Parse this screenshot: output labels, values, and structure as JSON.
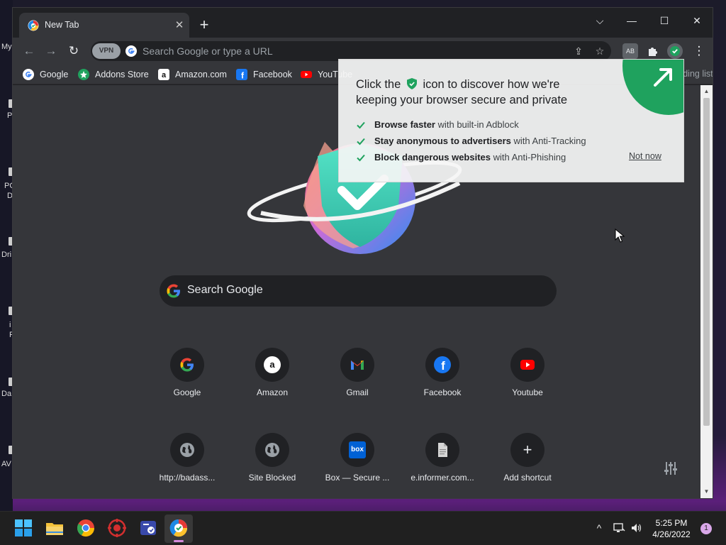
{
  "desktop": {
    "side_labels": [
      "My",
      "P",
      "PC",
      "D",
      "Dri",
      "i",
      "F",
      "Da",
      "AV"
    ]
  },
  "tab": {
    "title": "New Tab",
    "close_glyph": "✕"
  },
  "new_tab_glyph": "+",
  "window_controls": {
    "dropdown": "⌵",
    "minimize": "—",
    "maximize": "☐",
    "close": "✕"
  },
  "toolbar": {
    "back": "←",
    "forward": "→",
    "reload": "↻",
    "vpn_label": "VPN",
    "omnibox_placeholder": "Search Google or type a URL",
    "share": "⇪",
    "star": "☆",
    "menu": "⋮"
  },
  "bookmarks": [
    {
      "label": "Google",
      "icon": "google-icon"
    },
    {
      "label": "Addons Store",
      "icon": "addons-store-icon"
    },
    {
      "label": "Amazon.com",
      "icon": "amazon-icon"
    },
    {
      "label": "Facebook",
      "icon": "facebook-icon"
    },
    {
      "label": "YouTube",
      "icon": "youtube-icon"
    }
  ],
  "reading_list_label": "Reading list",
  "promo": {
    "title_before": "Click the",
    "title_after": "icon to discover how we're keeping your browser secure and private",
    "features": [
      {
        "bold": "Browse faster",
        "rest": " with built-in Adblock"
      },
      {
        "bold": "Stay anonymous to advertisers",
        "rest": " with Anti-Tracking"
      },
      {
        "bold": "Block dangerous websites",
        "rest": " with Anti-Phishing"
      }
    ],
    "not_now": "Not now"
  },
  "search": {
    "placeholder": "Search Google"
  },
  "shortcuts": [
    {
      "label": "Google",
      "icon": "google-icon"
    },
    {
      "label": "Amazon",
      "icon": "amazon-icon"
    },
    {
      "label": "Gmail",
      "icon": "gmail-icon"
    },
    {
      "label": "Facebook",
      "icon": "facebook-icon"
    },
    {
      "label": "Youtube",
      "icon": "youtube-icon"
    },
    {
      "label": "http://badass...",
      "icon": "globe-icon"
    },
    {
      "label": "Site Blocked",
      "icon": "globe-icon"
    },
    {
      "label": "Box — Secure ...",
      "icon": "box-icon",
      "icon_text": "box"
    },
    {
      "label": "e.informer.com...",
      "icon": "document-icon"
    },
    {
      "label": "Add shortcut",
      "icon": "plus-icon",
      "icon_text": "+"
    }
  ],
  "taskbar": {
    "apps": [
      "windows-start",
      "file-explorer",
      "chrome",
      "security-app",
      "remote-app",
      "avg-secure-browser"
    ],
    "clock_time": "5:25 PM",
    "clock_date": "4/26/2022",
    "notifications_count": "1",
    "tray_chevron": "^"
  },
  "colors": {
    "accent_green": "#1fa25e",
    "page_bg": "#35363a",
    "toolbar_bg": "#35363a",
    "tabstrip_bg": "#202124"
  }
}
